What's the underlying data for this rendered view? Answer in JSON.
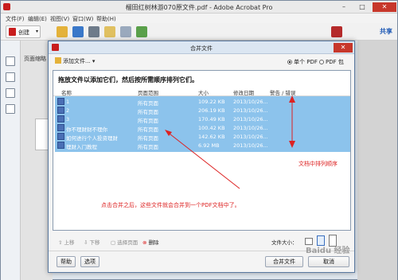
{
  "window": {
    "title": "榴田红树林游070原文件.pdf - Adobe Acrobat Pro",
    "minimize_glyph": "–",
    "maximize_glyph": "□",
    "close_glyph": "✕"
  },
  "menu": [
    "文件(F)",
    "编辑(E)",
    "视图(V)",
    "窗口(W)",
    "帮助(H)"
  ],
  "toolbar": {
    "create_label": "创建",
    "share_label": "共享"
  },
  "left_panel": {
    "title": "页面缩略"
  },
  "dialog": {
    "title": "合并文件",
    "close_glyph": "✕",
    "add_files_label": "添加文件...",
    "radio_single_pdf": "单个 PDF",
    "radio_pdf_package": "PDF 包",
    "instruction": "拖放文件以添加它们，然后按所需顺序排列它们。",
    "columns": {
      "name": "名称",
      "page_range": "页面范围",
      "size": "大小",
      "modified": "修改日期",
      "warnings": "警告 / 错误"
    },
    "rows": [
      {
        "name": "1",
        "range": "所有页面",
        "size": "109.22 KB",
        "date": "2013/10/26..."
      },
      {
        "name": "2",
        "range": "所有页面",
        "size": "206.19 KB",
        "date": "2013/10/26..."
      },
      {
        "name": "3",
        "range": "所有页面",
        "size": "170.49 KB",
        "date": "2013/10/26..."
      },
      {
        "name": "你不理财财不理你",
        "range": "所有页面",
        "size": "100.42 KB",
        "date": "2013/10/26..."
      },
      {
        "name": "如何进行个人投资理财",
        "range": "所有页面",
        "size": "142.62 KB",
        "date": "2013/10/26..."
      },
      {
        "name": "理财入门教程",
        "range": "所有页面",
        "size": "6.92 MB",
        "date": "2013/10/26..."
      }
    ],
    "bottom_tools": {
      "move_up": "上移",
      "move_down": "下移",
      "choose_pages": "选择页面",
      "delete": "删除",
      "file_size": "文件大小："
    },
    "buttons": {
      "help": "帮助",
      "options": "选项",
      "combine": "合并文件",
      "cancel": "取消"
    }
  },
  "annotations": {
    "sort_note": "文档中排列顺序",
    "merge_note": "点击合并之后，这些文件就会合并到一个PDF文档中了。"
  },
  "watermark": "Baidu 经验",
  "colors": {
    "selection": "#8cc3ec",
    "annotation": "#dd2222",
    "title_close": "#c7372b"
  }
}
